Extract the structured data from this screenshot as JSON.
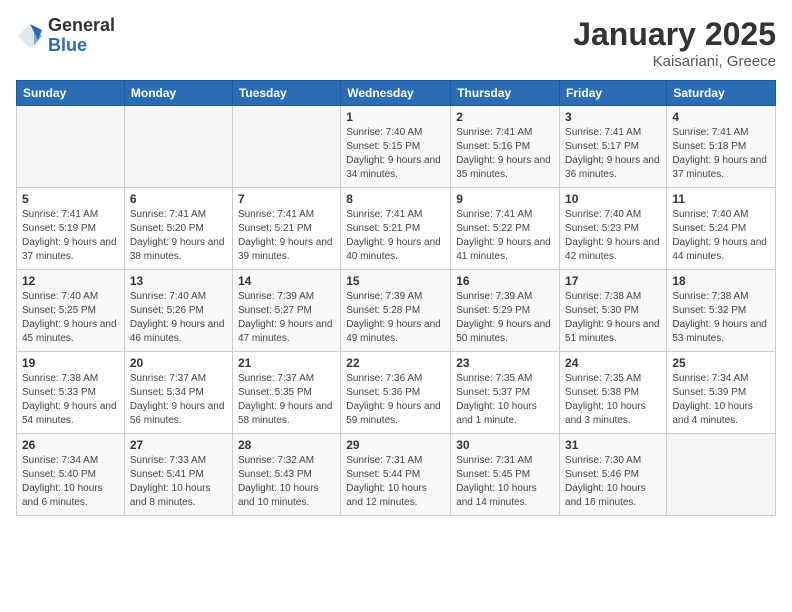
{
  "logo": {
    "general": "General",
    "blue": "Blue"
  },
  "title": "January 2025",
  "subtitle": "Kaisariani, Greece",
  "weekdays": [
    "Sunday",
    "Monday",
    "Tuesday",
    "Wednesday",
    "Thursday",
    "Friday",
    "Saturday"
  ],
  "weeks": [
    [
      {
        "day": "",
        "info": ""
      },
      {
        "day": "",
        "info": ""
      },
      {
        "day": "",
        "info": ""
      },
      {
        "day": "1",
        "info": "Sunrise: 7:40 AM\nSunset: 5:15 PM\nDaylight: 9 hours and 34 minutes."
      },
      {
        "day": "2",
        "info": "Sunrise: 7:41 AM\nSunset: 5:16 PM\nDaylight: 9 hours and 35 minutes."
      },
      {
        "day": "3",
        "info": "Sunrise: 7:41 AM\nSunset: 5:17 PM\nDaylight: 9 hours and 36 minutes."
      },
      {
        "day": "4",
        "info": "Sunrise: 7:41 AM\nSunset: 5:18 PM\nDaylight: 9 hours and 37 minutes."
      }
    ],
    [
      {
        "day": "5",
        "info": "Sunrise: 7:41 AM\nSunset: 5:19 PM\nDaylight: 9 hours and 37 minutes."
      },
      {
        "day": "6",
        "info": "Sunrise: 7:41 AM\nSunset: 5:20 PM\nDaylight: 9 hours and 38 minutes."
      },
      {
        "day": "7",
        "info": "Sunrise: 7:41 AM\nSunset: 5:21 PM\nDaylight: 9 hours and 39 minutes."
      },
      {
        "day": "8",
        "info": "Sunrise: 7:41 AM\nSunset: 5:21 PM\nDaylight: 9 hours and 40 minutes."
      },
      {
        "day": "9",
        "info": "Sunrise: 7:41 AM\nSunset: 5:22 PM\nDaylight: 9 hours and 41 minutes."
      },
      {
        "day": "10",
        "info": "Sunrise: 7:40 AM\nSunset: 5:23 PM\nDaylight: 9 hours and 42 minutes."
      },
      {
        "day": "11",
        "info": "Sunrise: 7:40 AM\nSunset: 5:24 PM\nDaylight: 9 hours and 44 minutes."
      }
    ],
    [
      {
        "day": "12",
        "info": "Sunrise: 7:40 AM\nSunset: 5:25 PM\nDaylight: 9 hours and 45 minutes."
      },
      {
        "day": "13",
        "info": "Sunrise: 7:40 AM\nSunset: 5:26 PM\nDaylight: 9 hours and 46 minutes."
      },
      {
        "day": "14",
        "info": "Sunrise: 7:39 AM\nSunset: 5:27 PM\nDaylight: 9 hours and 47 minutes."
      },
      {
        "day": "15",
        "info": "Sunrise: 7:39 AM\nSunset: 5:28 PM\nDaylight: 9 hours and 49 minutes."
      },
      {
        "day": "16",
        "info": "Sunrise: 7:39 AM\nSunset: 5:29 PM\nDaylight: 9 hours and 50 minutes."
      },
      {
        "day": "17",
        "info": "Sunrise: 7:38 AM\nSunset: 5:30 PM\nDaylight: 9 hours and 51 minutes."
      },
      {
        "day": "18",
        "info": "Sunrise: 7:38 AM\nSunset: 5:32 PM\nDaylight: 9 hours and 53 minutes."
      }
    ],
    [
      {
        "day": "19",
        "info": "Sunrise: 7:38 AM\nSunset: 5:33 PM\nDaylight: 9 hours and 54 minutes."
      },
      {
        "day": "20",
        "info": "Sunrise: 7:37 AM\nSunset: 5:34 PM\nDaylight: 9 hours and 56 minutes."
      },
      {
        "day": "21",
        "info": "Sunrise: 7:37 AM\nSunset: 5:35 PM\nDaylight: 9 hours and 58 minutes."
      },
      {
        "day": "22",
        "info": "Sunrise: 7:36 AM\nSunset: 5:36 PM\nDaylight: 9 hours and 59 minutes."
      },
      {
        "day": "23",
        "info": "Sunrise: 7:35 AM\nSunset: 5:37 PM\nDaylight: 10 hours and 1 minute."
      },
      {
        "day": "24",
        "info": "Sunrise: 7:35 AM\nSunset: 5:38 PM\nDaylight: 10 hours and 3 minutes."
      },
      {
        "day": "25",
        "info": "Sunrise: 7:34 AM\nSunset: 5:39 PM\nDaylight: 10 hours and 4 minutes."
      }
    ],
    [
      {
        "day": "26",
        "info": "Sunrise: 7:34 AM\nSunset: 5:40 PM\nDaylight: 10 hours and 6 minutes."
      },
      {
        "day": "27",
        "info": "Sunrise: 7:33 AM\nSunset: 5:41 PM\nDaylight: 10 hours and 8 minutes."
      },
      {
        "day": "28",
        "info": "Sunrise: 7:32 AM\nSunset: 5:43 PM\nDaylight: 10 hours and 10 minutes."
      },
      {
        "day": "29",
        "info": "Sunrise: 7:31 AM\nSunset: 5:44 PM\nDaylight: 10 hours and 12 minutes."
      },
      {
        "day": "30",
        "info": "Sunrise: 7:31 AM\nSunset: 5:45 PM\nDaylight: 10 hours and 14 minutes."
      },
      {
        "day": "31",
        "info": "Sunrise: 7:30 AM\nSunset: 5:46 PM\nDaylight: 10 hours and 16 minutes."
      },
      {
        "day": "",
        "info": ""
      }
    ]
  ]
}
